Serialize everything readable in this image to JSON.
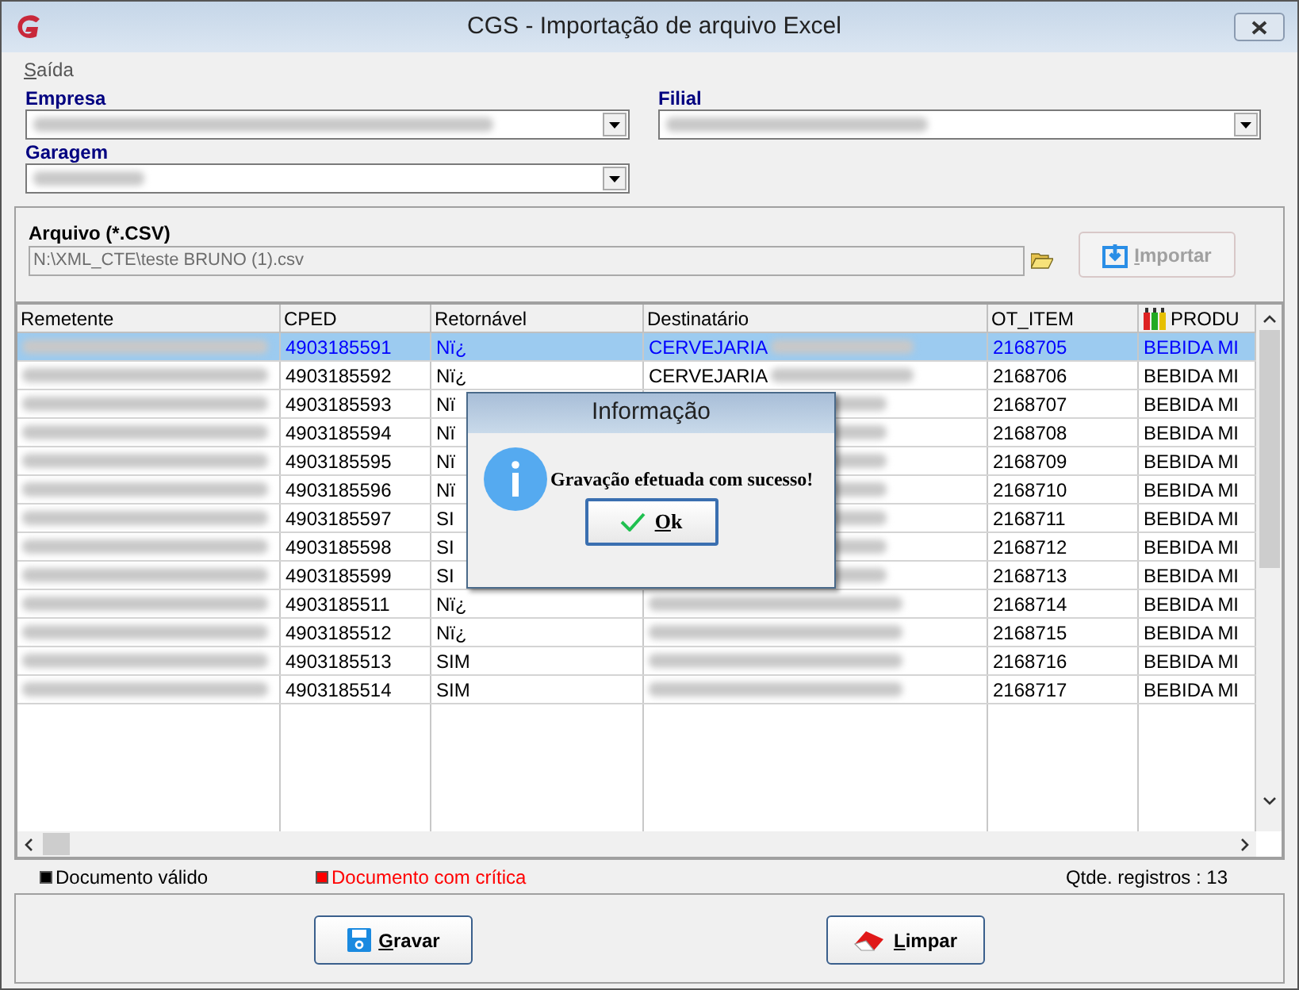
{
  "window": {
    "title": "CGS - Importação de arquivo Excel"
  },
  "menu": [
    {
      "label": "Saída"
    }
  ],
  "fields": {
    "empresa": {
      "label": "Empresa"
    },
    "filial": {
      "label": "Filial"
    },
    "garagem": {
      "label": "Garagem"
    }
  },
  "arquivo": {
    "label": "Arquivo (*.CSV)",
    "value": "N:\\XML_CTE\\teste BRUNO (1).csv",
    "import_button": {
      "label": "Importar",
      "disabled": true
    }
  },
  "table": {
    "columns": [
      "Remetente",
      "CPED",
      "Retornável",
      "Destinatário",
      "OT_ITEM",
      "PRODU"
    ],
    "rows": [
      {
        "selected": true,
        "cped": "4903185591",
        "retornavel": "Nï¿",
        "destinatario": "CERVEJARIA",
        "ot_item": "2168705",
        "produto": "BEBIDA MI"
      },
      {
        "selected": false,
        "cped": "4903185592",
        "retornavel": "Nï¿",
        "destinatario": "CERVEJARIA",
        "ot_item": "2168706",
        "produto": "BEBIDA MI"
      },
      {
        "selected": false,
        "cped": "4903185593",
        "retornavel": "Nï",
        "ot_item": "2168707",
        "produto": "BEBIDA MI"
      },
      {
        "selected": false,
        "cped": "4903185594",
        "retornavel": "Nï",
        "ot_item": "2168708",
        "produto": "BEBIDA MI"
      },
      {
        "selected": false,
        "cped": "4903185595",
        "retornavel": "Nï",
        "ot_item": "2168709",
        "produto": "BEBIDA MI"
      },
      {
        "selected": false,
        "cped": "4903185596",
        "retornavel": "Nï",
        "ot_item": "2168710",
        "produto": "BEBIDA MI"
      },
      {
        "selected": false,
        "cped": "4903185597",
        "retornavel": "SI",
        "ot_item": "2168711",
        "produto": "BEBIDA MI"
      },
      {
        "selected": false,
        "cped": "4903185598",
        "retornavel": "SI",
        "ot_item": "2168712",
        "produto": "BEBIDA MI"
      },
      {
        "selected": false,
        "cped": "4903185599",
        "retornavel": "SI",
        "ot_item": "2168713",
        "produto": "BEBIDA MI"
      },
      {
        "selected": false,
        "cped": "4903185511",
        "retornavel": "Nï¿",
        "ot_item": "2168714",
        "produto": "BEBIDA MI"
      },
      {
        "selected": false,
        "cped": "4903185512",
        "retornavel": "Nï¿",
        "ot_item": "2168715",
        "produto": "BEBIDA MI"
      },
      {
        "selected": false,
        "cped": "4903185513",
        "retornavel": "SIM",
        "ot_item": "2168716",
        "produto": "BEBIDA MI"
      },
      {
        "selected": false,
        "cped": "4903185514",
        "retornavel": "SIM",
        "ot_item": "2168717",
        "produto": "BEBIDA MI"
      }
    ]
  },
  "legend": [
    {
      "label": "Documento válido",
      "color": "#000000"
    },
    {
      "label": "Documento com crítica",
      "color": "#ff0000"
    }
  ],
  "record_count": "Qtde. registros : 13",
  "buttons": [
    {
      "kind": "save",
      "label": "Gravar"
    },
    {
      "kind": "clear",
      "label": "Limpar"
    }
  ],
  "dialog": {
    "title": "Informação",
    "message": "Gravação efetuada com sucesso!",
    "button": "Ok"
  }
}
